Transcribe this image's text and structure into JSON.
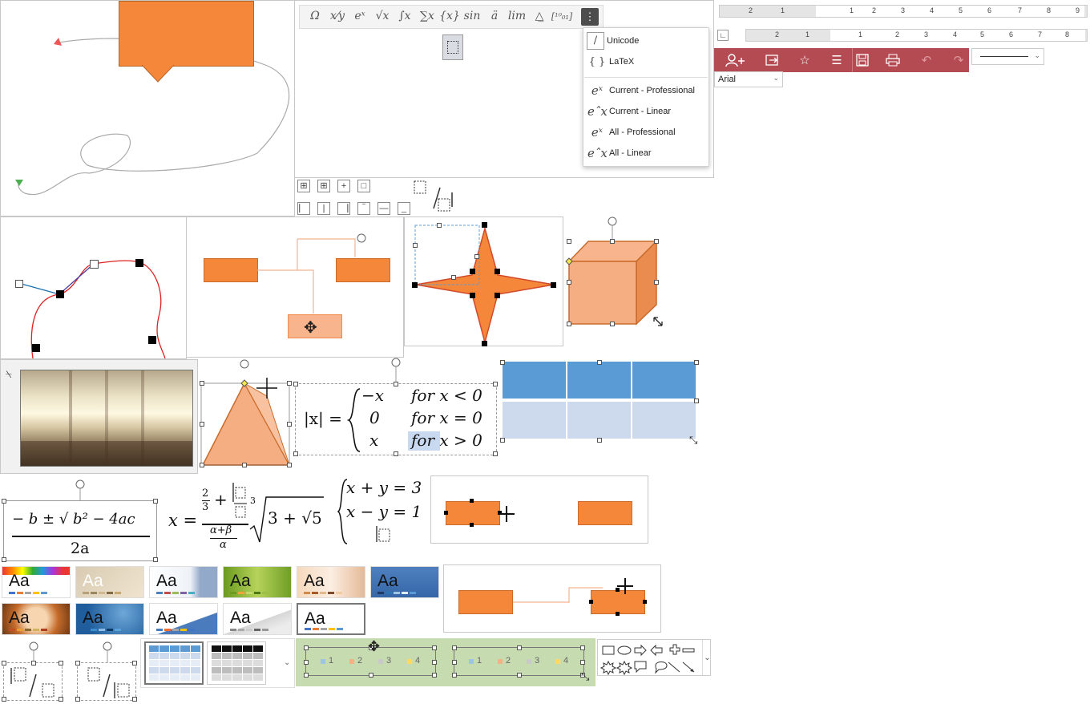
{
  "equation_toolbar": {
    "buttons": [
      {
        "glyph": "Ω",
        "name": "symbol"
      },
      {
        "glyph": "x⁄y",
        "name": "fraction"
      },
      {
        "glyph": "eˣ",
        "name": "script"
      },
      {
        "glyph": "√x",
        "name": "radical"
      },
      {
        "glyph": "∫x",
        "name": "integral"
      },
      {
        "glyph": "∑x",
        "name": "large-operator"
      },
      {
        "glyph": "{x}",
        "name": "bracket"
      },
      {
        "glyph": "sin",
        "name": "function"
      },
      {
        "glyph": "ä",
        "name": "accent"
      },
      {
        "glyph": "lim",
        "name": "limit-log"
      },
      {
        "glyph": "△̲",
        "name": "operator"
      },
      {
        "glyph": "[¹⁰₀₁]",
        "name": "matrix"
      }
    ]
  },
  "equation_menu": {
    "items": [
      {
        "icon": "/",
        "label": "Unicode"
      },
      {
        "icon": "{ }",
        "label": "LaTeX"
      },
      {
        "icon": "eˣ",
        "label": "Current - Professional"
      },
      {
        "icon": "eˆx",
        "label": "Current - Linear"
      },
      {
        "icon": "eˣ",
        "label": "All - Professional"
      },
      {
        "icon": "eˆx",
        "label": "All - Linear"
      }
    ]
  },
  "ruler_top": {
    "labels": [
      "2",
      "1",
      "1",
      "2",
      "3",
      "4",
      "5",
      "6",
      "7",
      "8",
      "9"
    ]
  },
  "ruler_second": {
    "labels": [
      "2",
      "1",
      "1",
      "2",
      "3",
      "4",
      "5",
      "6",
      "7",
      "8"
    ]
  },
  "font_select": {
    "value": "Arial"
  },
  "ribbon": {
    "accent": "#b44a52"
  },
  "equations": {
    "abs_lhs": "|x| =",
    "cases": [
      [
        "−x",
        "for x < 0"
      ],
      [
        "0",
        "for x = 0"
      ],
      [
        "x",
        "for x > 0"
      ]
    ],
    "quad_num": "− b ± √ b² − 4ac",
    "quad_den": "2a",
    "frac_lhs": "x =",
    "frac_top_num": "2",
    "frac_top_den": "3",
    "frac_bot_num": "α+β",
    "frac_bot_den": "α",
    "root_index": "3",
    "root_body": "3 + √5",
    "sys_eq1": "x + y = 3",
    "sys_eq2": "x − y = 1"
  },
  "themes": [
    {
      "label": "Aa"
    },
    {
      "label": "Aa"
    },
    {
      "label": "Aa"
    },
    {
      "label": "Aa"
    },
    {
      "label": "Aa"
    },
    {
      "label": "Aa"
    },
    {
      "label": "Aa"
    },
    {
      "label": "Aa"
    },
    {
      "label": "Aa"
    },
    {
      "label": "Aa"
    },
    {
      "label": "Aa"
    }
  ],
  "list_items": [
    "1",
    "2",
    "3",
    "4"
  ],
  "colors": {
    "orange": "#f5873a",
    "orange_light": "#f8b48c",
    "blue": "#5b9bd5",
    "blue_light": "#cdd9ec",
    "green_panel": "#c6dbb0"
  }
}
